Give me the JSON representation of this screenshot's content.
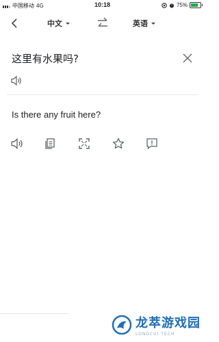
{
  "status_bar": {
    "carrier": "中国移动",
    "network": "4G",
    "time": "10:18",
    "battery_percent": "75%",
    "battery_level": 0.75
  },
  "toolbar": {
    "source_language": "中文",
    "target_language": "英语"
  },
  "source": {
    "text": "这里有水果吗?"
  },
  "result": {
    "text": "Is there any fruit here?"
  },
  "icons": {
    "back": "chevron-left-icon",
    "swap": "swap-arrows-icon",
    "clear": "close-icon",
    "speaker": "speaker-icon",
    "copy": "copy-icon",
    "fullscreen": "fullscreen-icon",
    "star": "star-icon",
    "feedback": "feedback-icon"
  },
  "watermark": {
    "title": "龙萃游戏园",
    "subtitle": "LONGCUI TECH"
  },
  "colors": {
    "accent": "#1f6fb8",
    "battery": "#22a855",
    "icon_gray": "#5f6368"
  }
}
